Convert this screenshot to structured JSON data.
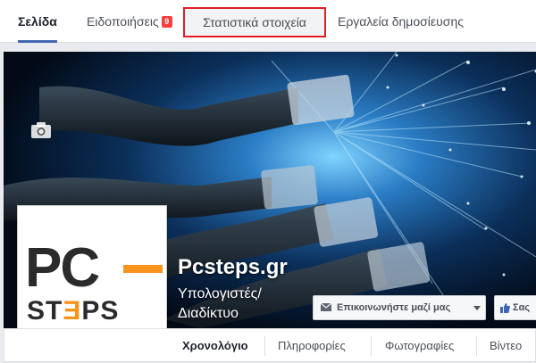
{
  "tabs": {
    "page": "Σελίδα",
    "notifications": "Ειδοποιήσεις",
    "notifications_count": "9",
    "statistics": "Στατιστικά στοιχεία",
    "publishing_tools": "Εργαλεία δημοσίευσης"
  },
  "cover": {
    "camera_icon": "camera-icon"
  },
  "profile": {
    "logo_top": "PC",
    "logo_bottom_a": "ST",
    "logo_bottom_e": "Ǝ",
    "logo_bottom_b": "PS",
    "camera_icon": "camera-icon"
  },
  "page_info": {
    "name": "Pcsteps.gr",
    "category": "Υπολογιστές/ Διαδίκτυο"
  },
  "actions": {
    "contact": "Επικοινωνήστε μαζί μας",
    "like_partial": "Σας"
  },
  "timeline_nav": {
    "timeline": "Χρονολόγιο",
    "info": "Πληροφορίες",
    "photos": "Φωτογραφίες",
    "videos": "Βίντεο"
  },
  "colors": {
    "accent": "#4267b2",
    "highlight_border": "#e41e25",
    "badge": "#fa3e3e",
    "logo_orange": "#f7941d"
  }
}
